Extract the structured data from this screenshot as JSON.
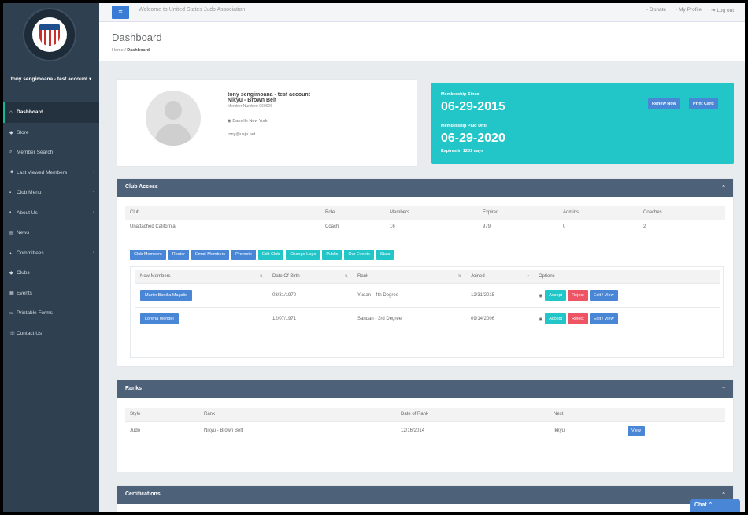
{
  "topbar": {
    "welcome": "Welcome to United States Judo Association",
    "links": [
      "Donate",
      "My Profile",
      "Log out"
    ]
  },
  "sidebar": {
    "user": "tony sengimoana - test account",
    "items": [
      {
        "label": "Dashboard",
        "icon": "home-icon",
        "active": true
      },
      {
        "label": "Store",
        "icon": "tag-icon"
      },
      {
        "label": "Member Search",
        "icon": "search-icon"
      },
      {
        "label": "Last Viewed Members",
        "icon": "users-icon",
        "has_children": true
      },
      {
        "label": "Club Menu",
        "icon": "sitemap-icon",
        "has_children": true
      },
      {
        "label": "About Us",
        "icon": "info-icon",
        "has_children": true
      },
      {
        "label": "News",
        "icon": "newspaper-icon"
      },
      {
        "label": "Committees",
        "icon": "committee-icon",
        "has_children": true
      },
      {
        "label": "Clubs",
        "icon": "tag-icon"
      },
      {
        "label": "Events",
        "icon": "calendar-icon"
      },
      {
        "label": "Printable Forms",
        "icon": "print-icon"
      },
      {
        "label": "Contact Us",
        "icon": "phone-icon"
      }
    ]
  },
  "page": {
    "title": "Dashboard",
    "breadcrumb": {
      "home": "Home",
      "current": "Dashboard"
    }
  },
  "profile": {
    "name": "tony sengimoana - test account",
    "rank": "Nikyu - Brown Belt",
    "member_number": "Member Number: 060006",
    "location": "Danville New York",
    "email": "tony@usja.net"
  },
  "membership": {
    "since_label": "Membership Since",
    "since_date": "06-29-2015",
    "paid_label": "Membership Paid Until",
    "paid_date": "06-29-2020",
    "expires": "Expires in 1281 days",
    "renew_label": "Renew Now",
    "print_label": "Print Card"
  },
  "club_access": {
    "title": "Club Access",
    "headers": [
      "Club",
      "Role",
      "Members",
      "Expired",
      "Admins",
      "Coaches"
    ],
    "row": [
      "Unattached California",
      "Coach",
      "16",
      "979",
      "0",
      "2"
    ],
    "buttons": [
      {
        "label": "Club Members",
        "color": "blue"
      },
      {
        "label": "Roster",
        "color": "blue"
      },
      {
        "label": "Email Members",
        "color": "blue"
      },
      {
        "label": "Promote",
        "color": "blue"
      },
      {
        "label": "Edit Club",
        "color": "teal"
      },
      {
        "label": "Change Logo",
        "color": "teal"
      },
      {
        "label": "Public",
        "color": "teal"
      },
      {
        "label": "Our Events",
        "color": "teal"
      },
      {
        "label": "Stats",
        "color": "teal"
      }
    ],
    "new_members": {
      "headers": [
        "New Members",
        "Date Of Birth",
        "Rank",
        "Joined",
        "Options"
      ],
      "rows": [
        {
          "name": "Martin Bonilla Magalie",
          "dob": "08/31/1970",
          "rank": "Yudan - 4th Degree",
          "joined": "12/31/2015"
        },
        {
          "name": "Lorena Mendel",
          "dob": "12/07/1971",
          "rank": "Sandan - 3rd Degree",
          "joined": "09/14/2006"
        }
      ],
      "accept_label": "Accept",
      "reject_label": "Reject",
      "edit_label": "Edit / View"
    }
  },
  "ranks": {
    "title": "Ranks",
    "headers": [
      "Style",
      "Rank",
      "Date of Rank",
      "Next"
    ],
    "row": [
      "Judo",
      "Nikyu - Brown Belt",
      "12/16/2014",
      "Ikkyu"
    ],
    "view_label": "View"
  },
  "certifications": {
    "title": "Certifications"
  },
  "chat": {
    "label": "Chat"
  }
}
